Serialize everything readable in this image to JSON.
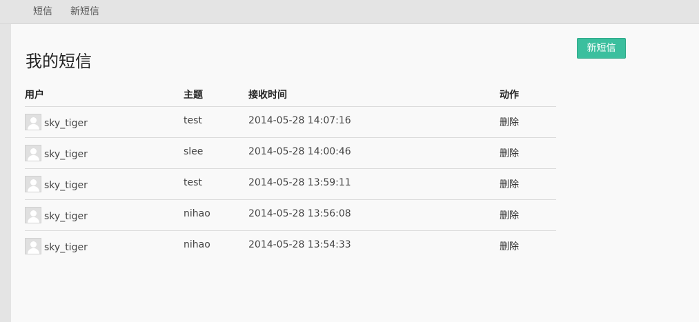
{
  "nav": {
    "items": [
      {
        "label": "短信"
      },
      {
        "label": "新短信"
      }
    ]
  },
  "page": {
    "title": "我的短信",
    "new_button_label": "新短信"
  },
  "table": {
    "headers": {
      "user": "用户",
      "subject": "主题",
      "time": "接收时间",
      "action": "动作"
    },
    "rows": [
      {
        "user": "sky_tiger",
        "subject": "test",
        "time": "2014-05-28 14:07:16",
        "action": "删除"
      },
      {
        "user": "sky_tiger",
        "subject": "slee",
        "time": "2014-05-28 14:00:46",
        "action": "删除"
      },
      {
        "user": "sky_tiger",
        "subject": "test",
        "time": "2014-05-28 13:59:11",
        "action": "删除"
      },
      {
        "user": "sky_tiger",
        "subject": "nihao",
        "time": "2014-05-28 13:56:08",
        "action": "删除"
      },
      {
        "user": "sky_tiger",
        "subject": "nihao",
        "time": "2014-05-28 13:54:33",
        "action": "删除"
      }
    ]
  },
  "colors": {
    "accent": "#3bbf9e",
    "background": "#e4e4e4",
    "panel": "#f9f9f9"
  }
}
